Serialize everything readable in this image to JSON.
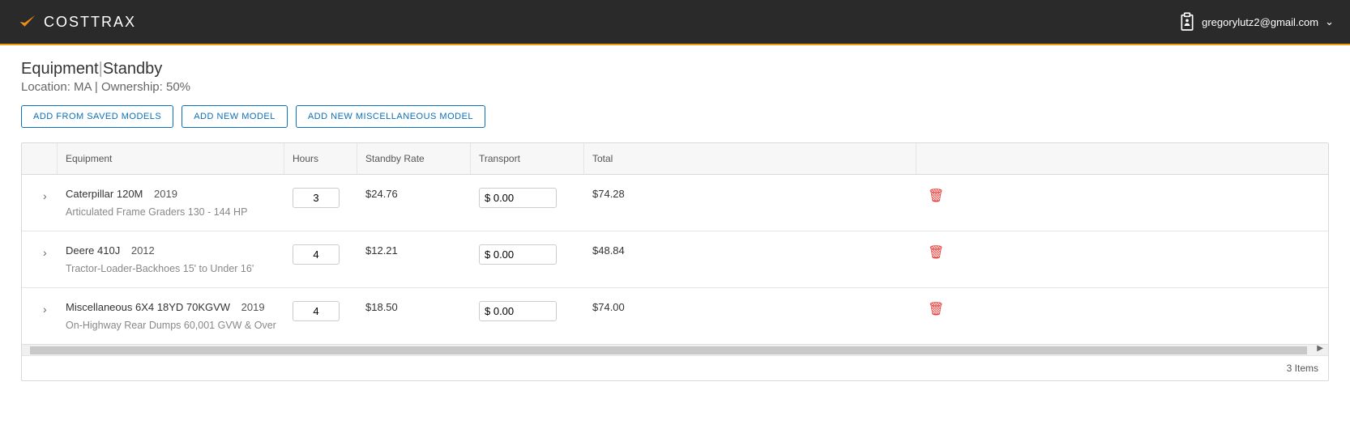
{
  "app": {
    "name": "COSTTRAX"
  },
  "user": {
    "email": "gregorylutz2@gmail.com"
  },
  "section": {
    "heading_a": "Equipment",
    "heading_b": "Standby",
    "sub": "Location: MA | Ownership: 50%"
  },
  "buttons": {
    "add_saved": "ADD FROM SAVED MODELS",
    "add_new": "ADD NEW MODEL",
    "add_misc": "ADD NEW MISCELLANEOUS MODEL"
  },
  "columns": {
    "equipment": "Equipment",
    "hours": "Hours",
    "rate": "Standby Rate",
    "transport": "Transport",
    "total": "Total"
  },
  "rows": [
    {
      "name": "Caterpillar 120M",
      "year": "2019",
      "desc": "Articulated Frame Graders 130 - 144 HP",
      "hours": "3",
      "rate": "$24.76",
      "transport": "$ 0.00",
      "total": "$74.28"
    },
    {
      "name": "Deere 410J",
      "year": "2012",
      "desc": "Tractor-Loader-Backhoes 15' to Under 16'",
      "hours": "4",
      "rate": "$12.21",
      "transport": "$ 0.00",
      "total": "$48.84"
    },
    {
      "name": "Miscellaneous 6X4 18YD 70KGVW",
      "year": "2019",
      "desc": "On-Highway Rear Dumps 60,001 GVW & Over",
      "hours": "4",
      "rate": "$18.50",
      "transport": "$ 0.00",
      "total": "$74.00"
    }
  ],
  "footer": {
    "count_label": "3 Items"
  }
}
